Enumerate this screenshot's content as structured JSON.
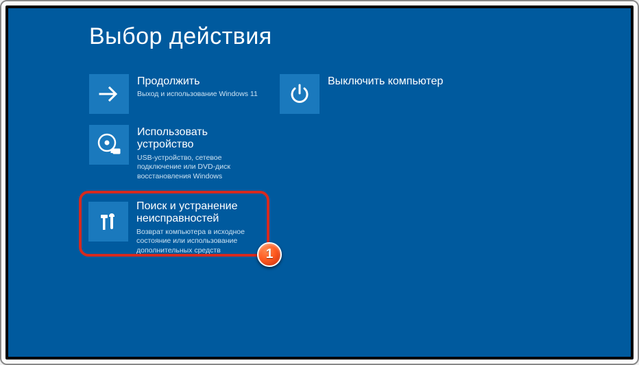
{
  "title": "Выбор действия",
  "tiles": {
    "continue": {
      "title": "Продолжить",
      "desc": "Выход и использование Windows 11"
    },
    "shutdown": {
      "title": "Выключить компьютер"
    },
    "useDevice": {
      "title": "Использовать устройство",
      "desc": "USB-устройство, сетевое подключение или DVD-диск восстановления Windows"
    },
    "troubleshoot": {
      "title": "Поиск и устранение неисправностей",
      "desc": "Возврат компьютера в исходное состояние или использование дополнительных средств"
    }
  },
  "callout": "1"
}
